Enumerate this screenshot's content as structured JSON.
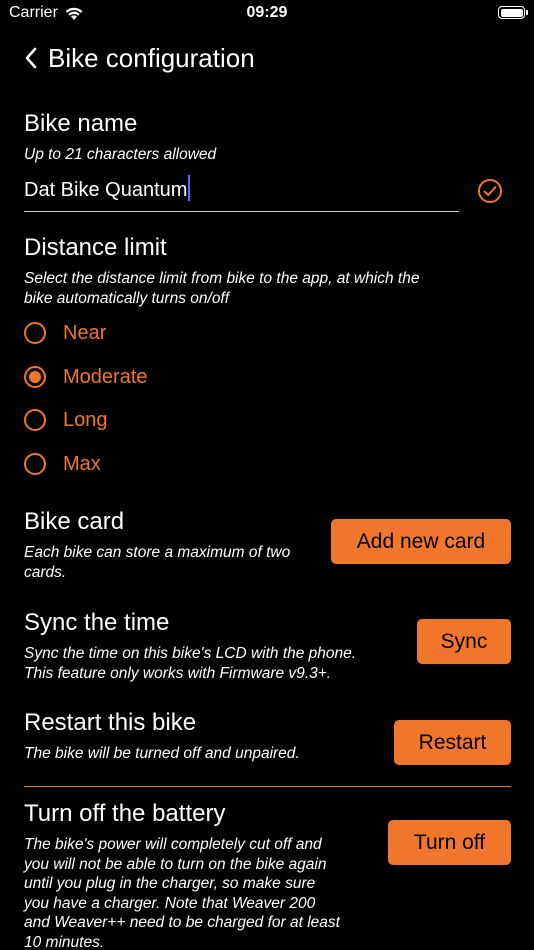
{
  "status_bar": {
    "carrier": "Carrier",
    "time": "09:29"
  },
  "nav": {
    "title": "Bike configuration",
    "back_icon": "chevron-left-icon"
  },
  "bike_name": {
    "title": "Bike name",
    "hint": "Up to 21 characters allowed",
    "value": "Dat Bike Quantum",
    "confirm_icon": "check-circle-icon"
  },
  "distance_limit": {
    "title": "Distance limit",
    "hint_line1": "Select the distance limit from bike to the app, at which the",
    "hint_line2": "bike automatically turns on/off",
    "options": [
      {
        "label": "Near",
        "selected": false
      },
      {
        "label": "Moderate",
        "selected": true
      },
      {
        "label": "Long",
        "selected": false
      },
      {
        "label": "Max",
        "selected": false
      }
    ]
  },
  "bike_card": {
    "title": "Bike card",
    "hint_line1": "Each bike can store a maximum of two",
    "hint_line2": "cards.",
    "button": "Add new card"
  },
  "sync_time": {
    "title": "Sync the time",
    "hint_line1": "Sync the time on this bike's LCD with the phone.",
    "hint_line2": "This feature only works with Firmware v9.3+.",
    "button": "Sync"
  },
  "restart": {
    "title": "Restart this bike",
    "hint": "The bike will be turned off and unpaired.",
    "button": "Restart"
  },
  "battery_off": {
    "title": "Turn off the battery",
    "hint_lines": [
      "The bike's power will completely cut off and",
      "you will not be able to turn on the bike again",
      "until you plug in the charger, so make sure",
      "you have a charger. Note that Weaver 200",
      "and Weaver++ need to be charged for at least",
      "10 minutes."
    ],
    "button": "Turn off"
  },
  "colors": {
    "accent": "#f0762b",
    "background": "#000000",
    "text": "#ffffff"
  }
}
